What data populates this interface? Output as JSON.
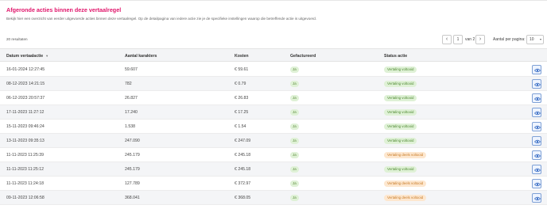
{
  "header": {
    "title": "Afgeronde acties binnen deze vertaalregel",
    "description": "Bekijk hier een overzicht van eerder uitgevoerde acties binnen deze vertaalregel. Op de detailpagina van iedere actie zie je de specifieke instellingen waarop die betreffende actie is uitgevoerd."
  },
  "results": {
    "count_label": "20 resultaten"
  },
  "pagination": {
    "prev_icon": "chevron-left-icon",
    "current_page": "1",
    "of_label": "van 2",
    "next_icon": "chevron-right-icon",
    "per_page_label": "Aantal per pagina:",
    "per_page_value": "10"
  },
  "table": {
    "columns": {
      "date": "Datum vertaalactie",
      "chars": "Aantal karakters",
      "cost": "Kosten",
      "billed": "Gefactureerd",
      "status": "Status actie"
    },
    "rows": [
      {
        "date": "16-01-2024 12:27:45",
        "chars": "59.607",
        "cost": "€ 59.61",
        "billed": "Ja",
        "status": "Vertaling voltooid",
        "status_kind": "ok"
      },
      {
        "date": "08-12-2023 14:21:15",
        "chars": "782",
        "cost": "€ 0.79",
        "billed": "Ja",
        "status": "Vertaling voltooid",
        "status_kind": "ok"
      },
      {
        "date": "06-12-2023 20:57:37",
        "chars": "26.827",
        "cost": "€ 26.83",
        "billed": "Ja",
        "status": "Vertaling voltooid",
        "status_kind": "ok"
      },
      {
        "date": "17-11-2023 11:27:12",
        "chars": "17.240",
        "cost": "€ 17.25",
        "billed": "Ja",
        "status": "Vertaling voltooid",
        "status_kind": "ok"
      },
      {
        "date": "15-11-2023 09:46:24",
        "chars": "1.538",
        "cost": "€ 1.54",
        "billed": "Ja",
        "status": "Vertaling voltooid",
        "status_kind": "ok"
      },
      {
        "date": "13-11-2023 09:35:13",
        "chars": "247.090",
        "cost": "€ 247.09",
        "billed": "Ja",
        "status": "Vertaling voltooid",
        "status_kind": "ok"
      },
      {
        "date": "11-11-2023 11:25:39",
        "chars": "245.179",
        "cost": "€ 245.18",
        "billed": "Ja",
        "status": "Vertaling deels voltooid",
        "status_kind": "part"
      },
      {
        "date": "11-11-2023 11:25:12",
        "chars": "245.179",
        "cost": "€ 245.18",
        "billed": "Ja",
        "status": "Vertaling voltooid",
        "status_kind": "ok"
      },
      {
        "date": "11-11-2023 11:24:18",
        "chars": "127.789",
        "cost": "€ 372.97",
        "billed": "Ja",
        "status": "Vertaling deels voltooid",
        "status_kind": "part"
      },
      {
        "date": "09-11-2023 12:06:58",
        "chars": "368.041",
        "cost": "€ 368.05",
        "billed": "Ja",
        "status": "Vertaling deels voltooid",
        "status_kind": "part"
      }
    ],
    "row_action_icon": "eye-icon"
  },
  "colors": {
    "accent": "#e0166b",
    "ok_bg": "#dff1d6",
    "partial_bg": "#fde7cf",
    "view_border": "#7fa1d6"
  }
}
